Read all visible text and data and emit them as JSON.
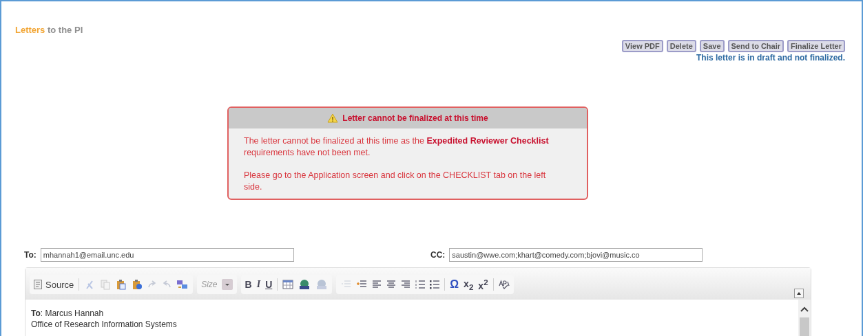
{
  "title": {
    "highlight": "Letters",
    "rest": "to the PI"
  },
  "actions": [
    "View PDF",
    "Delete",
    "Save",
    "Send to Chair",
    "Finalize Letter"
  ],
  "status": "This letter is in draft and not finalized.",
  "alert": {
    "title": "Letter cannot be finalized at this time",
    "paragraphs": [
      "The letter cannot be finalized at this time as the **Expedited Reviewer Checklist** requirements have not been met.",
      "Please go to the Application screen and click on the CHECKLIST tab on the left side."
    ]
  },
  "to": {
    "label": "To:",
    "value": "mhannah1@email.unc.edu"
  },
  "cc": {
    "label": "CC:",
    "value": "saustin@wwe.com;khart@comedy.com;bjovi@music.co"
  },
  "toolbar": {
    "source": "Source",
    "size": "Size",
    "format": [
      "B",
      "I",
      "U"
    ],
    "symbols": [
      "Ω",
      "x$_{2}$",
      "x$^{2}$"
    ]
  },
  "body": [
    "**To**: Marcus Hannah",
    "Office of Research Information Systems"
  ]
}
